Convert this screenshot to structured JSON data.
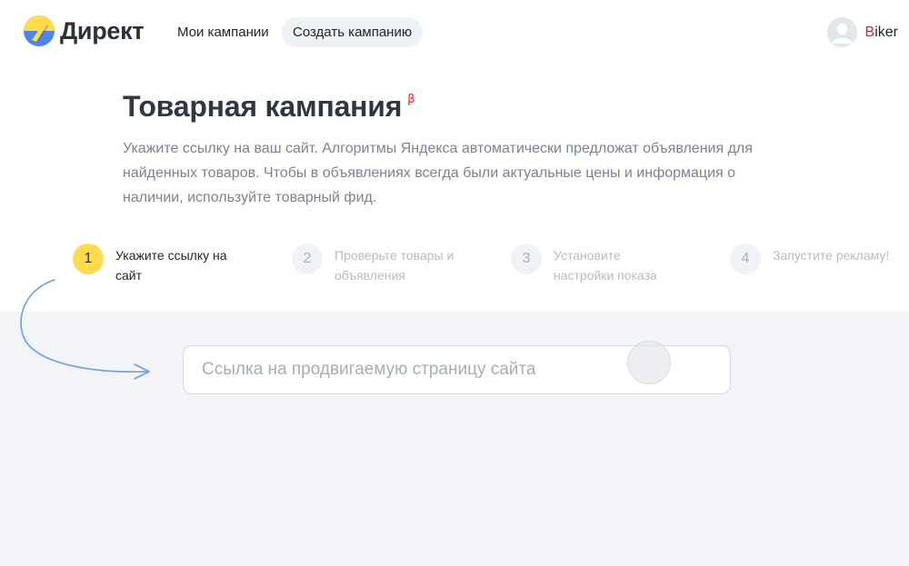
{
  "header": {
    "logo_text": "Директ",
    "nav": [
      {
        "label": "Мои кампании"
      },
      {
        "label": "Создать кампанию"
      }
    ],
    "user": {
      "name_first": "B",
      "name_rest": "iker"
    }
  },
  "page": {
    "title": "Товарная кампания",
    "beta_mark": "β",
    "description": "Укажите ссылку на ваш сайт. Алгоритмы Яндекса автоматически предложат объявления для найденных товаров. Чтобы в объявлениях всегда были актуальные цены и информация о наличии, используйте товарный фид."
  },
  "steps": [
    {
      "num": "1",
      "label": "Укажите ссылку на сайт",
      "active": true
    },
    {
      "num": "2",
      "label": "Проверьте товары и объявления",
      "active": false
    },
    {
      "num": "3",
      "label": "Установите настройки показа",
      "active": false
    },
    {
      "num": "4",
      "label": "Запустите рекламу!",
      "active": false
    }
  ],
  "url_input": {
    "placeholder": "Ссылка на продвигаемую страницу сайта",
    "value": ""
  },
  "colors": {
    "accent_yellow": "#ffdb4d",
    "beta_red": "#e31e24",
    "panel_bg": "#f2f4f8",
    "arrow_blue": "#6a9be8"
  },
  "icons": {
    "logo": "yandex-direct-logo-icon",
    "avatar": "user-avatar-icon",
    "arrow": "curved-arrow-icon"
  }
}
